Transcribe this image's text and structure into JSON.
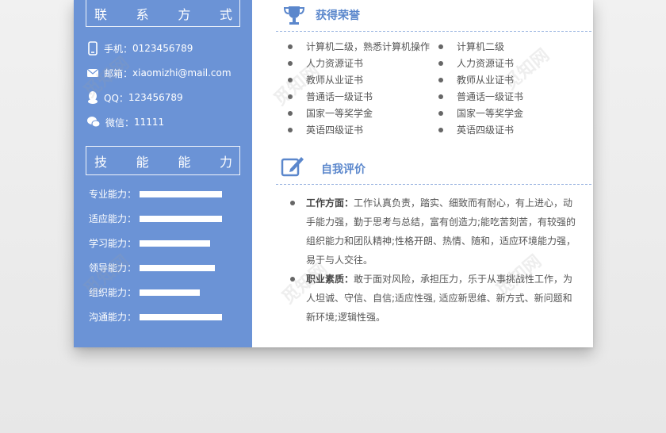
{
  "sidebar": {
    "contact_heading": [
      "联",
      "系",
      "方",
      "式"
    ],
    "contact": [
      {
        "icon": "phone-icon",
        "label": "手机：",
        "value": "0123456789"
      },
      {
        "icon": "mail-icon",
        "label": "邮箱：",
        "value": "xiaomizhi@mail.com"
      },
      {
        "icon": "qq-icon",
        "label": "QQ：",
        "value": "123456789"
      },
      {
        "icon": "wechat-icon",
        "label": "微信：",
        "value": "11111"
      }
    ],
    "skills_heading": [
      "技",
      "能",
      "能",
      "力"
    ],
    "skills": [
      {
        "label": "专业能力：",
        "level": 0.77
      },
      {
        "label": "适应能力：",
        "level": 0.77
      },
      {
        "label": "学习能力：",
        "level": 0.66
      },
      {
        "label": "领导能力：",
        "level": 0.7
      },
      {
        "label": "组织能力：",
        "level": 0.56
      },
      {
        "label": "沟通能力：",
        "level": 0.77
      }
    ]
  },
  "honors": {
    "title": "获得荣誉",
    "left": [
      "计算机二级，熟悉计算机操作",
      "人力资源证书",
      "教师从业证书",
      "普通话一级证书",
      "国家一等奖学金",
      "英语四级证书"
    ],
    "right": [
      "计算机二级",
      "人力资源证书",
      "教师从业证书",
      "普通话一级证书",
      "国家一等奖学金",
      "英语四级证书"
    ]
  },
  "evaluation": {
    "title": "自我评价",
    "items": [
      {
        "label": "工作方面：",
        "text": "工作认真负责，踏实、细致而有耐心，有上进心，动手能力强，勤于思考与总结，富有创造力;能吃苦刻苦，有较强的组织能力和团队精神;性格开朗、热情、随和，适应环境能力强，易于与人交往。"
      },
      {
        "label": "职业素质：",
        "text": "敢于面对风险，承担压力，乐于从事挑战性工作，为人坦诚、守信、自信;适应性强, 适应新思维、新方式、新问题和新环境;逻辑性强。"
      }
    ]
  },
  "watermark": "觅知网",
  "colors": {
    "accent": "#6b93d6",
    "title": "#5b87cc"
  }
}
